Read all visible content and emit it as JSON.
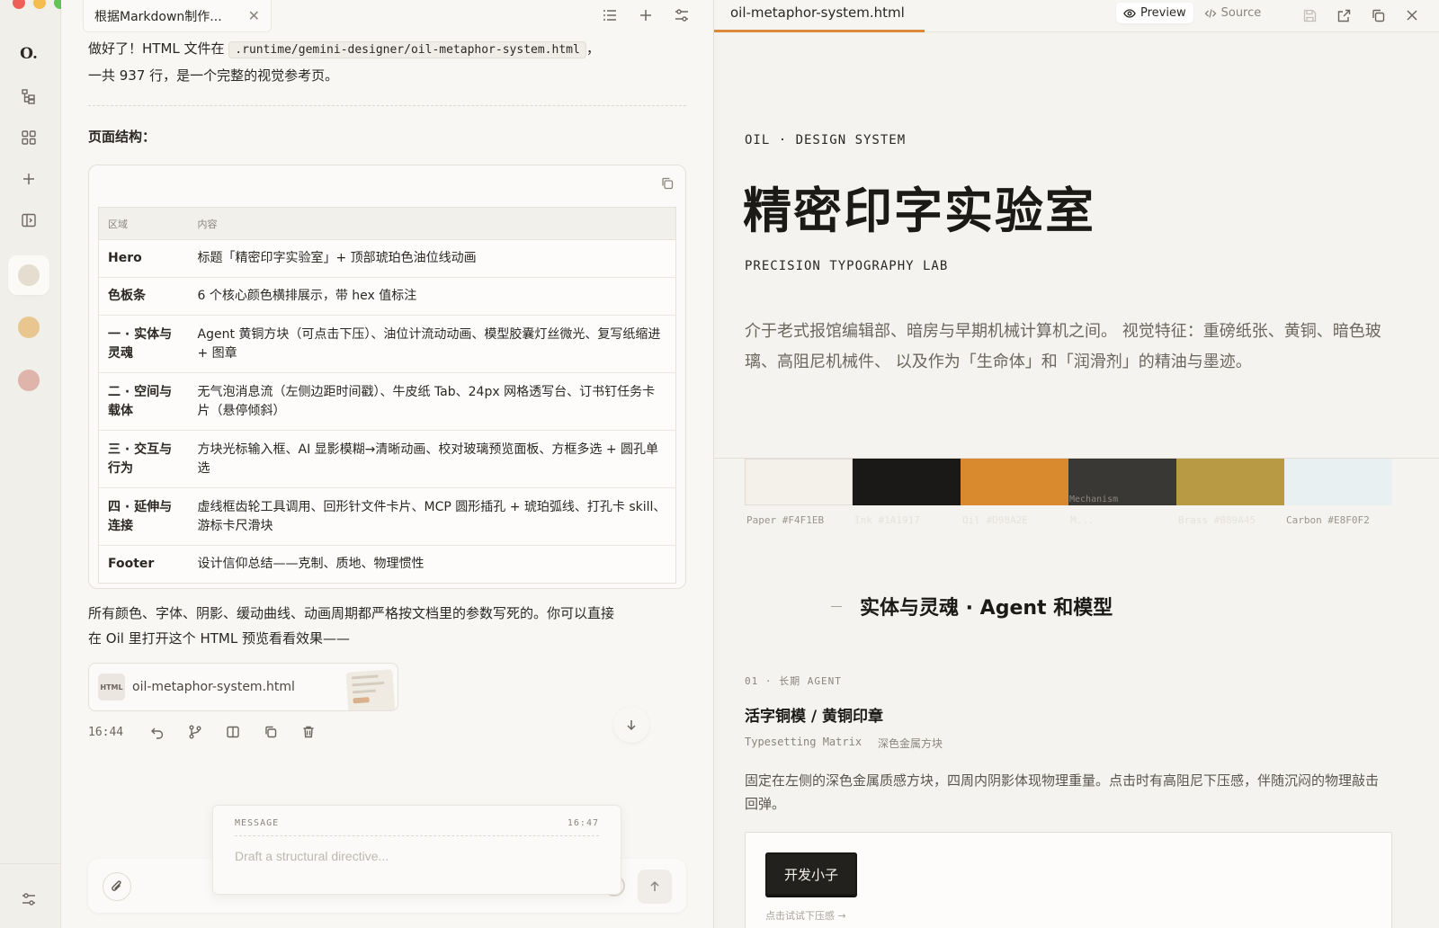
{
  "window": {
    "traffic_lights": [
      "#ee5f58",
      "#f5bd4f",
      "#61c454"
    ]
  },
  "rail": {
    "logo": "O.",
    "avatars": [
      {
        "color": "#e4ddd0",
        "active": true
      },
      {
        "color": "#e9c68f",
        "active": false
      },
      {
        "color": "#dfb4aa",
        "active": false
      }
    ]
  },
  "chat": {
    "tab_title": "根据Markdown制作...",
    "intro_line1_prefix": "做好了！HTML 文件在",
    "intro_path": ".runtime/gemini-designer/oil-metaphor-system.html",
    "intro_line1_suffix": "，",
    "intro_line2": "一共 937 行，是一个完整的视觉参考页。",
    "structure_heading": "页面结构：",
    "table": {
      "headers": [
        "区域",
        "内容"
      ],
      "rows": [
        {
          "area": "Hero",
          "content": "标题「精密印字实验室」+ 顶部琥珀色油位线动画"
        },
        {
          "area": "色板条",
          "content": "6 个核心颜色横排展示，带 hex 值标注"
        },
        {
          "area": "一 · 实体与灵魂",
          "content": "Agent 黄铜方块（可点击下压）、油位计流动动画、模型胶囊灯丝微光、复写纸缩进 + 图章"
        },
        {
          "area": "二 · 空间与载体",
          "content": "无气泡消息流（左侧边距时间戳）、牛皮纸 Tab、24px 网格透写台、订书钉任务卡片（悬停倾斜）"
        },
        {
          "area": "三 · 交互与行为",
          "content": "方块光标输入框、AI 显影模糊→清晰动画、校对玻璃预览面板、方框多选 + 圆孔单选"
        },
        {
          "area": "四 · 延伸与连接",
          "content": "虚线框齿轮工具调用、回形针文件卡片、MCP 圆形插孔 + 琥珀弧线、打孔卡 skill、游标卡尺滑块"
        },
        {
          "area": "Footer",
          "content": "设计信仰总结——克制、质地、物理惯性"
        }
      ]
    },
    "closing_line1": "所有颜色、字体、阴影、缓动曲线、动画周期都严格按文档里的参数写死的。你可以直接",
    "closing_line2": "在 Oil 里打开这个 HTML 预览看看效果——",
    "file_card": {
      "badge": "HTML",
      "name": "oil-metaphor-system.html"
    },
    "message_time": "16:44",
    "draft": {
      "label": "MESSAGE",
      "time": "16:47",
      "placeholder": "Draft a structural directive..."
    }
  },
  "preview": {
    "tab_title": "oil-metaphor-system.html",
    "mode_preview": "Preview",
    "mode_source": "Source",
    "accent": "#d98a3a",
    "kicker": "OIL · DESIGN SYSTEM",
    "title": "精密印字实验室",
    "subtitle": "PRECISION TYPOGRAPHY LAB",
    "lead": "介于老式报馆编辑部、暗房与早期机械计算机之间。 视觉特征：重磅纸张、黄铜、暗色玻璃、高阻尼机械件、 以及作为「生命体」和「润滑剂」的精油与墨迹。",
    "swatches": [
      {
        "color": "#f4f1eb",
        "label": "Paper #F4F1EB",
        "chip_text": "",
        "faint": false
      },
      {
        "color": "#1a1917",
        "label": "Ink #1A1917",
        "chip_text": "",
        "faint": true
      },
      {
        "color": "#d98a2e",
        "label": "Oil #D98A2E",
        "chip_text": "",
        "faint": true
      },
      {
        "color": "#3a3835",
        "label": "M...",
        "chip_text": "Mechanism",
        "faint": true
      },
      {
        "color": "#b89a45",
        "label": "Brass #B89A45",
        "chip_text": "",
        "faint": true
      },
      {
        "color": "#e8f0f2",
        "label": "Carbon #E8F0F2",
        "chip_text": "",
        "faint": false
      }
    ],
    "section_title": "实体与灵魂 · Agent 和模型",
    "item": {
      "num": "01 · 长期 AGENT",
      "title": "活字铜模 / 黄铜印章",
      "tag_en": "Typesetting Matrix",
      "tag_cn": "深色金属方块",
      "desc": "固定在左侧的深色金属质感方块，四周内阴影体现物理重量。点击时有高阻尼下压感，伴随沉闷的物理敲击回弹。",
      "button": "开发小子",
      "hint": "点击试试下压感 →"
    }
  }
}
